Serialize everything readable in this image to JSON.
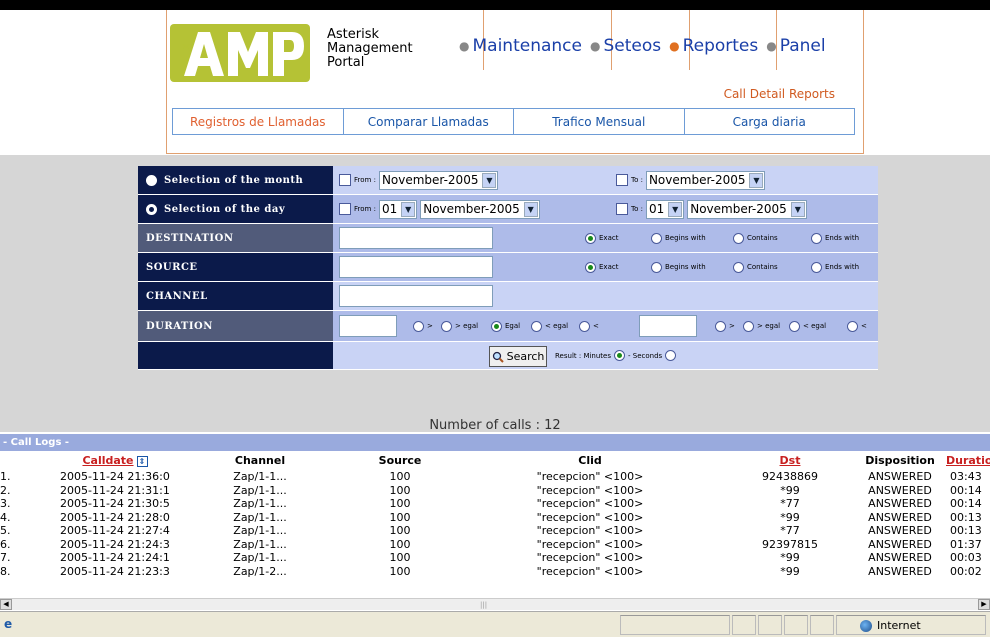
{
  "header": {
    "logo_text": "AMP",
    "logo_caption": [
      "Asterisk",
      "Management",
      "Portal"
    ],
    "nav": [
      {
        "label": "Maintenance",
        "dot": "grey"
      },
      {
        "label": "Seteos",
        "dot": "grey"
      },
      {
        "label": "Reportes",
        "dot": "orange"
      },
      {
        "label": "Panel",
        "dot": "grey"
      }
    ],
    "section_label": "Call Detail Reports",
    "subnav": [
      {
        "label": "Registros de Llamadas",
        "active": true
      },
      {
        "label": "Comparar Llamadas",
        "active": false
      },
      {
        "label": "Trafico Mensual",
        "active": false
      },
      {
        "label": "Carga diaria",
        "active": false
      }
    ]
  },
  "form": {
    "month": {
      "label": "Selection of the month",
      "from_label": "From :",
      "from_value": "November-2005",
      "to_label": "To :",
      "to_value": "November-2005"
    },
    "day": {
      "label": "Selection of the day",
      "from_label": "From :",
      "from_day": "01",
      "from_month": "November-2005",
      "to_label": "To :",
      "to_day": "01",
      "to_month": "November-2005"
    },
    "destination": {
      "label": "DESTINATION",
      "options": [
        "Exact",
        "Begins with",
        "Contains",
        "Ends with"
      ],
      "selected": "Exact"
    },
    "source": {
      "label": "SOURCE",
      "options": [
        "Exact",
        "Begins with",
        "Contains",
        "Ends with"
      ],
      "selected": "Exact"
    },
    "channel": {
      "label": "CHANNEL"
    },
    "duration": {
      "label": "DURATION",
      "left_ops": [
        ">",
        "> egal",
        "Egal",
        "< egal",
        "<"
      ],
      "right_ops": [
        ">",
        "> egal",
        "< egal",
        "<"
      ]
    },
    "search_label": "Search",
    "result_label": "Result : Minutes",
    "seconds_label": "- Seconds"
  },
  "num_calls": "Number of calls : 12",
  "logs": {
    "title": "- Call Logs -",
    "columns": [
      "Calldate",
      "Channel",
      "Source",
      "Clid",
      "Dst",
      "Disposition",
      "Duratio"
    ],
    "rows": [
      [
        "1.",
        "2005-11-24 21:36:00",
        "Zap/1-1...",
        "100",
        "\"recepcion\" <100>",
        "92438869",
        "ANSWERED",
        "03:43"
      ],
      [
        "2.",
        "2005-11-24 21:31:13",
        "Zap/1-1...",
        "100",
        "\"recepcion\" <100>",
        "*99",
        "ANSWERED",
        "00:14"
      ],
      [
        "3.",
        "2005-11-24 21:30:56",
        "Zap/1-1...",
        "100",
        "\"recepcion\" <100>",
        "*77",
        "ANSWERED",
        "00:14"
      ],
      [
        "4.",
        "2005-11-24 21:28:04",
        "Zap/1-1...",
        "100",
        "\"recepcion\" <100>",
        "*99",
        "ANSWERED",
        "00:13"
      ],
      [
        "5.",
        "2005-11-24 21:27:48",
        "Zap/1-1...",
        "100",
        "\"recepcion\" <100>",
        "*77",
        "ANSWERED",
        "00:13"
      ],
      [
        "6.",
        "2005-11-24 21:24:32",
        "Zap/1-1...",
        "100",
        "\"recepcion\" <100>",
        "92397815",
        "ANSWERED",
        "01:37"
      ],
      [
        "7.",
        "2005-11-24 21:24:15",
        "Zap/1-1...",
        "100",
        "\"recepcion\" <100>",
        "*99",
        "ANSWERED",
        "00:03"
      ],
      [
        "8.",
        "2005-11-24 21:23:33",
        "Zap/1-2...",
        "100",
        "\"recepcion\" <100>",
        "*99",
        "ANSWERED",
        "00:02"
      ]
    ]
  },
  "status": {
    "zone": "Internet"
  }
}
